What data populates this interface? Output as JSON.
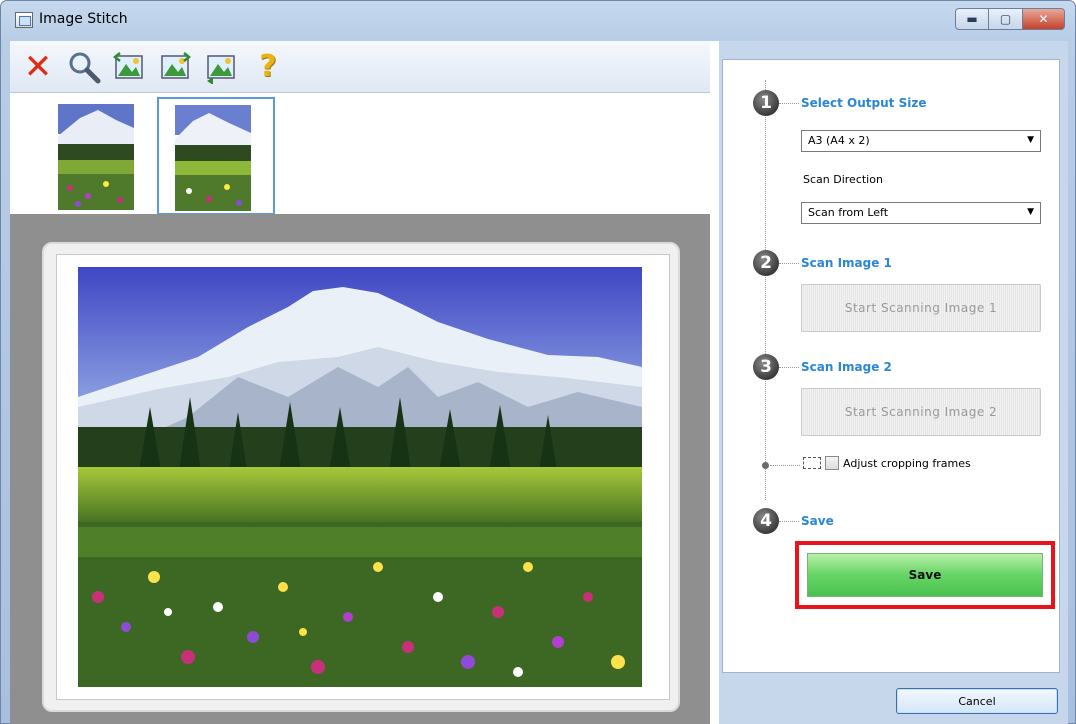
{
  "window": {
    "title": "Image Stitch"
  },
  "toolbar": {
    "items": [
      "delete-icon",
      "zoom-icon",
      "image-icon-1",
      "image-icon-2",
      "image-icon-3",
      "help-icon"
    ]
  },
  "steps": {
    "step1": {
      "number": "1",
      "label": "Select Output Size"
    },
    "output_size": {
      "value": "A3 (A4 x 2)"
    },
    "scan_direction_label": "Scan Direction",
    "scan_direction": {
      "value": "Scan from Left"
    },
    "step2": {
      "number": "2",
      "label": "Scan Image 1"
    },
    "scan_image1_button": "Start Scanning Image 1",
    "step3": {
      "number": "3",
      "label": "Scan Image 2"
    },
    "scan_image2_button": "Start Scanning Image 2",
    "adjust_cropping_label": "Adjust cropping frames",
    "step4": {
      "number": "4",
      "label": "Save"
    },
    "save_button": "Save"
  },
  "footer": {
    "cancel_button": "Cancel"
  },
  "colors": {
    "step_label": "#2a86d6",
    "highlight": "#e8141b",
    "save_green": "#66d467"
  }
}
